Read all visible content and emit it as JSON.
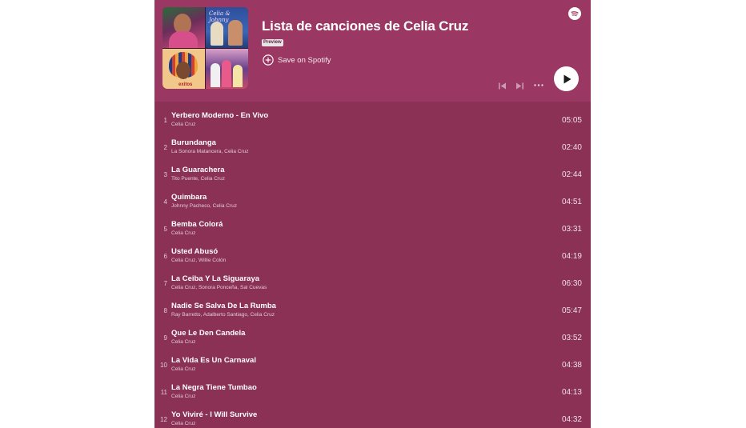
{
  "playlist": {
    "title": "Lista de canciones de Celia Cruz",
    "badge": "Preview",
    "save_label": "Save on Spotify",
    "cover_text": {
      "tile2": "Celia & Johnny",
      "tile3": "exitos"
    }
  },
  "icons": {
    "spotify": "spotify-icon",
    "add": "add-circle-icon",
    "previous": "skip-previous-icon",
    "next": "skip-next-icon",
    "more": "more-icon",
    "play": "play-icon"
  },
  "colors": {
    "header_bg": "#9a3762",
    "list_bg": "#8a3155",
    "text": "#ffffff",
    "subtext": "#e3c9d5"
  },
  "tracks": [
    {
      "num": "1",
      "title": "Yerbero Moderno - En Vivo",
      "artist": "Celia Cruz",
      "duration": "05:05"
    },
    {
      "num": "2",
      "title": "Burundanga",
      "artist": "La Sonora Matancera, Celia Cruz",
      "duration": "02:40"
    },
    {
      "num": "3",
      "title": "La Guarachera",
      "artist": "Tito Puente, Celia Cruz",
      "duration": "02:44"
    },
    {
      "num": "4",
      "title": "Quimbara",
      "artist": "Johnny Pacheco, Celia Cruz",
      "duration": "04:51"
    },
    {
      "num": "5",
      "title": "Bemba Colorá",
      "artist": "Celia Cruz",
      "duration": "03:31"
    },
    {
      "num": "6",
      "title": "Usted Abusó",
      "artist": "Celia Cruz, Willie Colón",
      "duration": "04:19"
    },
    {
      "num": "7",
      "title": "La Ceiba Y La Siguaraya",
      "artist": "Celia Cruz, Sonora Ponceña, Sal Cuevas",
      "duration": "06:30"
    },
    {
      "num": "8",
      "title": "Nadie Se Salva De La Rumba",
      "artist": "Ray Barretto, Adalberto Santiago, Celia Cruz",
      "duration": "05:47"
    },
    {
      "num": "9",
      "title": "Que Le Den Candela",
      "artist": "Celia Cruz",
      "duration": "03:52"
    },
    {
      "num": "10",
      "title": "La Vida Es Un Carnaval",
      "artist": "Celia Cruz",
      "duration": "04:38"
    },
    {
      "num": "11",
      "title": "La Negra Tiene Tumbao",
      "artist": "Celia Cruz",
      "duration": "04:13"
    },
    {
      "num": "12",
      "title": "Yo Viviré - I Will Survive",
      "artist": "Celia Cruz",
      "duration": "04:32"
    }
  ]
}
